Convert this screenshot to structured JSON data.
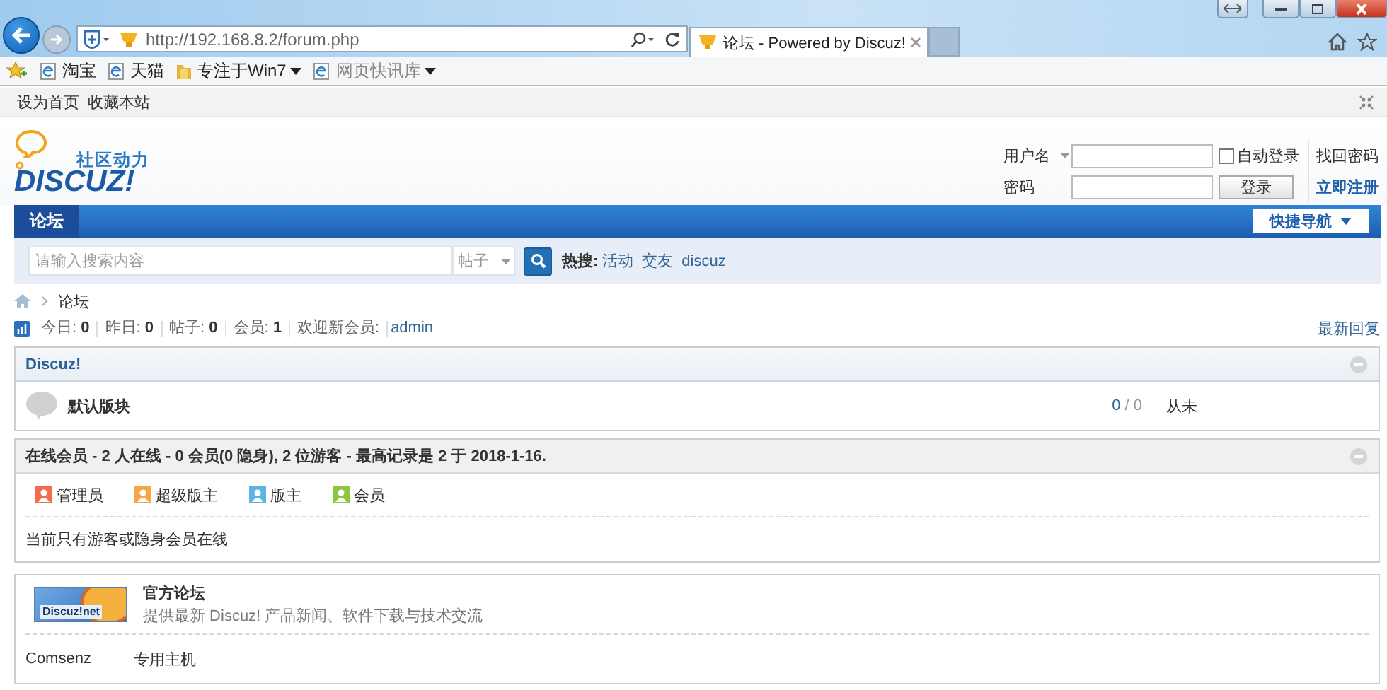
{
  "browser": {
    "url": "http://192.168.8.2/forum.php",
    "tab_title": "论坛 - Powered by Discuz!",
    "favorites": [
      {
        "label": "淘宝",
        "kind": "page",
        "menu": false,
        "disabled": false
      },
      {
        "label": "天猫",
        "kind": "page",
        "menu": false,
        "disabled": false
      },
      {
        "label": "专注于Win7",
        "kind": "folder",
        "menu": true,
        "disabled": false
      },
      {
        "label": "网页快讯库",
        "kind": "page",
        "menu": true,
        "disabled": true
      }
    ]
  },
  "topbar": {
    "links": [
      "设为首页",
      "收藏本站"
    ]
  },
  "logo": {
    "slogan": "社区动力",
    "wordmark": "DISCUZ!"
  },
  "login": {
    "username_label": "用户名",
    "password_label": "密码",
    "auto_login": {
      "label": "自动登录",
      "checked": false
    },
    "button": "登录",
    "forgot": "找回密码",
    "register": "立即注册"
  },
  "nav": {
    "items": [
      {
        "label": "论坛",
        "selected": true
      }
    ],
    "quick_nav": "快捷导航"
  },
  "search": {
    "placeholder": "请输入搜索内容",
    "type": "帖子",
    "hot_label": "热搜:",
    "hot": [
      "活动",
      "交友",
      "discuz"
    ]
  },
  "breadcrumb": [
    "论坛"
  ],
  "stats": [
    {
      "label": "今日:",
      "value": "0"
    },
    {
      "label": "昨日:",
      "value": "0"
    },
    {
      "label": "帖子:",
      "value": "0"
    },
    {
      "label": "会员:",
      "value": "1"
    }
  ],
  "new_member": {
    "label": "欢迎新会员:",
    "name": "admin"
  },
  "latest_replies": "最新回复",
  "category": {
    "title": "Discuz!",
    "forums": [
      {
        "name": "默认版块",
        "threads": "0",
        "posts": "/ 0",
        "last": "从未"
      }
    ]
  },
  "online": {
    "title": "在线会员 - 2 人在线 - 0 会员(0 隐身), 2 位游客 - 最高记录是 2 于 2018-1-16.",
    "legend": [
      {
        "label": "管理员",
        "color": "#f26c4f"
      },
      {
        "label": "超级版主",
        "color": "#f5a548"
      },
      {
        "label": "版主",
        "color": "#5ab4e5"
      },
      {
        "label": "会员",
        "color": "#8cc63f"
      }
    ],
    "message": "当前只有游客或隐身会员在线"
  },
  "links": {
    "featured": [
      {
        "name": "官方论坛",
        "description": "提供最新 Discuz! 产品新闻、软件下载与技术交流",
        "banner_text": "Discuz!net"
      }
    ],
    "text_links": [
      "Comsenz",
      "专用主机"
    ]
  }
}
